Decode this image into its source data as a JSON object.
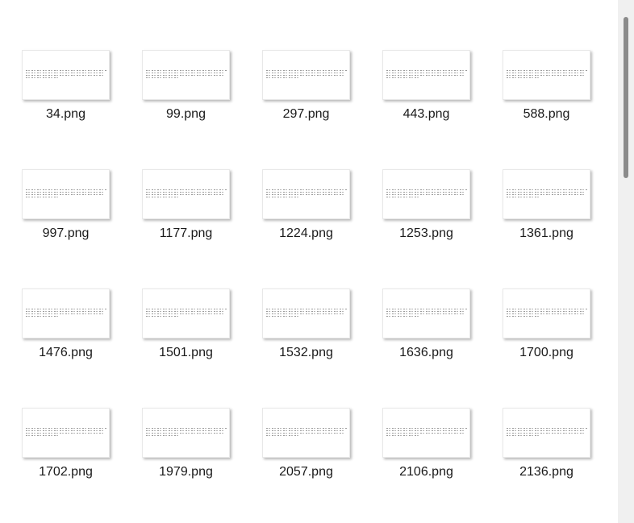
{
  "files": [
    {
      "name": "34.png"
    },
    {
      "name": "99.png"
    },
    {
      "name": "297.png"
    },
    {
      "name": "443.png"
    },
    {
      "name": "588.png"
    },
    {
      "name": "997.png"
    },
    {
      "name": "1177.png"
    },
    {
      "name": "1224.png"
    },
    {
      "name": "1253.png"
    },
    {
      "name": "1361.png"
    },
    {
      "name": "1476.png"
    },
    {
      "name": "1501.png"
    },
    {
      "name": "1532.png"
    },
    {
      "name": "1636.png"
    },
    {
      "name": "1700.png"
    },
    {
      "name": "1702.png"
    },
    {
      "name": "1979.png"
    },
    {
      "name": "2057.png"
    },
    {
      "name": "2106.png"
    },
    {
      "name": "2136.png"
    }
  ],
  "colors": {
    "background": "#ffffff",
    "label": "#1a1a1a",
    "scroll_track": "#f0f0f0",
    "scroll_thumb": "#8b8b8b"
  }
}
